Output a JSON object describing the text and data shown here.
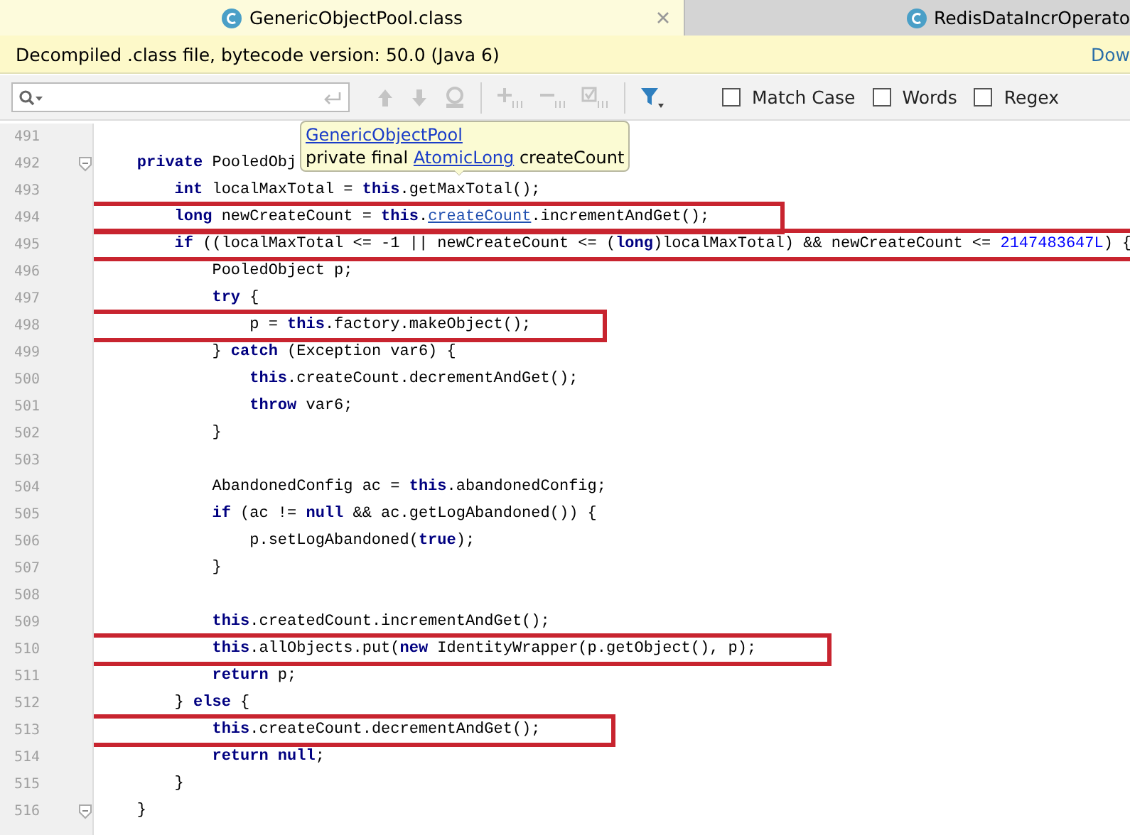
{
  "tabs": [
    {
      "label": "GenericObjectPool.class",
      "selected": true
    },
    {
      "label": "RedisDataIncrOperato",
      "selected": false
    }
  ],
  "banner": {
    "message": "Decompiled .class file, bytecode version: 50.0 (Java 6)",
    "link": "Dow"
  },
  "search": {
    "options": [
      {
        "label": "Match Case",
        "checked": false
      },
      {
        "label": "Words",
        "checked": false
      },
      {
        "label": "Regex",
        "checked": false
      }
    ]
  },
  "tooltip": {
    "title": "GenericObjectPool",
    "prefix": "private final ",
    "type": "AtomicLong",
    "suffix": " createCount"
  },
  "lines": [
    {
      "number": "491"
    },
    {
      "number": "492",
      "fold": true,
      "segments": [
        {
          "kind": "keyword",
          "text": "    private"
        },
        {
          "kind": "plain",
          "text": " PooledObj"
        }
      ]
    },
    {
      "number": "493",
      "segments": [
        {
          "kind": "keyword",
          "text": "        int"
        },
        {
          "kind": "plain",
          "text": " localMaxTotal = "
        },
        {
          "kind": "keyword",
          "text": "this"
        },
        {
          "kind": "plain",
          "text": ".getMaxTotal();"
        }
      ]
    },
    {
      "number": "494",
      "highlighted": true,
      "segments": [
        {
          "kind": "keyword",
          "text": "        long"
        },
        {
          "kind": "plain",
          "text": " newCreateCount = "
        },
        {
          "kind": "keyword",
          "text": "this"
        },
        {
          "kind": "plain",
          "text": "."
        },
        {
          "kind": "link",
          "text": "createCount"
        },
        {
          "kind": "plain",
          "text": ".incrementAndGet();"
        }
      ]
    },
    {
      "number": "495",
      "highlighted": true,
      "segments": [
        {
          "kind": "keyword",
          "text": "        if"
        },
        {
          "kind": "plain",
          "text": " ((localMaxTotal <= -1 || newCreateCount <= ("
        },
        {
          "kind": "keyword",
          "text": "long"
        },
        {
          "kind": "plain",
          "text": ")localMaxTotal) && newCreateCount <= "
        },
        {
          "kind": "number",
          "text": "2147483647L"
        },
        {
          "kind": "plain",
          "text": ") {"
        }
      ]
    },
    {
      "number": "496",
      "segments": [
        {
          "kind": "plain",
          "text": "            PooledObject p;"
        }
      ]
    },
    {
      "number": "497",
      "segments": [
        {
          "kind": "keyword",
          "text": "            try"
        },
        {
          "kind": "plain",
          "text": " {"
        }
      ]
    },
    {
      "number": "498",
      "highlighted": true,
      "segments": [
        {
          "kind": "plain",
          "text": "                p = "
        },
        {
          "kind": "keyword",
          "text": "this"
        },
        {
          "kind": "plain",
          "text": ".factory.makeObject();"
        }
      ]
    },
    {
      "number": "499",
      "segments": [
        {
          "kind": "plain",
          "text": "            } "
        },
        {
          "kind": "keyword",
          "text": "catch"
        },
        {
          "kind": "plain",
          "text": " (Exception var6) {"
        }
      ]
    },
    {
      "number": "500",
      "segments": [
        {
          "kind": "keyword",
          "text": "                this"
        },
        {
          "kind": "plain",
          "text": ".createCount.decrementAndGet();"
        }
      ]
    },
    {
      "number": "501",
      "segments": [
        {
          "kind": "keyword",
          "text": "                throw"
        },
        {
          "kind": "plain",
          "text": " var6;"
        }
      ]
    },
    {
      "number": "502",
      "segments": [
        {
          "kind": "plain",
          "text": "            }"
        }
      ]
    },
    {
      "number": "503"
    },
    {
      "number": "504",
      "segments": [
        {
          "kind": "plain",
          "text": "            AbandonedConfig ac = "
        },
        {
          "kind": "keyword",
          "text": "this"
        },
        {
          "kind": "plain",
          "text": ".abandonedConfig;"
        }
      ]
    },
    {
      "number": "505",
      "segments": [
        {
          "kind": "keyword",
          "text": "            if"
        },
        {
          "kind": "plain",
          "text": " (ac != "
        },
        {
          "kind": "keyword",
          "text": "null"
        },
        {
          "kind": "plain",
          "text": " && ac.getLogAbandoned()) {"
        }
      ]
    },
    {
      "number": "506",
      "segments": [
        {
          "kind": "plain",
          "text": "                p.setLogAbandoned("
        },
        {
          "kind": "keyword",
          "text": "true"
        },
        {
          "kind": "plain",
          "text": ");"
        }
      ]
    },
    {
      "number": "507",
      "segments": [
        {
          "kind": "plain",
          "text": "            }"
        }
      ]
    },
    {
      "number": "508"
    },
    {
      "number": "509",
      "segments": [
        {
          "kind": "keyword",
          "text": "            this"
        },
        {
          "kind": "plain",
          "text": ".createdCount.incrementAndGet();"
        }
      ]
    },
    {
      "number": "510",
      "highlighted": true,
      "segments": [
        {
          "kind": "keyword",
          "text": "            this"
        },
        {
          "kind": "plain",
          "text": ".allObjects.put("
        },
        {
          "kind": "keyword",
          "text": "new"
        },
        {
          "kind": "plain",
          "text": " IdentityWrapper(p.getObject(), p);"
        }
      ]
    },
    {
      "number": "511",
      "segments": [
        {
          "kind": "keyword",
          "text": "            return"
        },
        {
          "kind": "plain",
          "text": " p;"
        }
      ]
    },
    {
      "number": "512",
      "segments": [
        {
          "kind": "plain",
          "text": "        } "
        },
        {
          "kind": "keyword",
          "text": "else"
        },
        {
          "kind": "plain",
          "text": " {"
        }
      ]
    },
    {
      "number": "513",
      "highlighted": true,
      "segments": [
        {
          "kind": "keyword",
          "text": "            this"
        },
        {
          "kind": "plain",
          "text": ".createCount.decrementAndGet();"
        }
      ]
    },
    {
      "number": "514",
      "segments": [
        {
          "kind": "keyword",
          "text": "            return null"
        },
        {
          "kind": "plain",
          "text": ";"
        }
      ]
    },
    {
      "number": "515",
      "segments": [
        {
          "kind": "plain",
          "text": "        }"
        }
      ]
    },
    {
      "number": "516",
      "fold": true,
      "segments": [
        {
          "kind": "plain",
          "text": "    }"
        }
      ]
    }
  ]
}
